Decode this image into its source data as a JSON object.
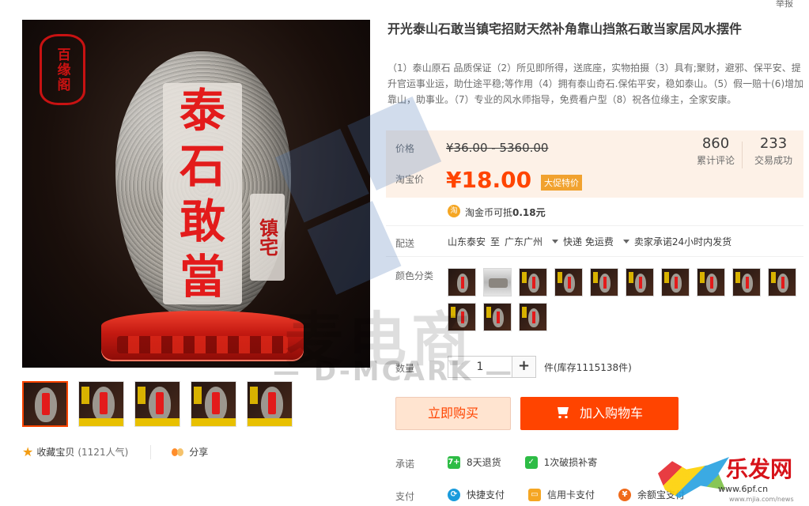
{
  "top": {
    "report_label": "举报"
  },
  "main_image": {
    "seal_text": "百缘阁",
    "carving_main": [
      "泰",
      "石",
      "敢",
      "當"
    ],
    "carving_side": "镇宅"
  },
  "watermark": {
    "text": "麦电商",
    "sub": "— D-MCARK —"
  },
  "thumbnails": [
    {
      "variant": "main",
      "active": true
    },
    {
      "variant": "gold",
      "active": false
    },
    {
      "variant": "gold",
      "active": false
    },
    {
      "variant": "gold",
      "active": false
    },
    {
      "variant": "gold",
      "active": false
    }
  ],
  "actions": {
    "favorite_label": "收藏宝贝",
    "favorite_count": "(1121人气)",
    "share_label": "分享"
  },
  "product": {
    "title": "开光泰山石敢当镇宅招财天然补角靠山挡煞石敢当家居风水摆件",
    "subtitle": "（1）泰山原石 品质保证（2）所见即所得，送底座，实物拍摄（3）具有;聚财，避邪、保平安、提升官运事业运，助仕途平稳;等作用（4）拥有泰山奇石.保佑平安，稳如泰山。（5）假一赔十(6)增加靠山，助事业。（7）专业的风水师指导，免费看户型（8）祝各位缘主，全家安康。"
  },
  "price": {
    "price_label": "价格",
    "original": "¥36.00 - 5360.00",
    "promo_label": "淘宝价",
    "promo_value": "¥18.00",
    "promo_tag": "大促特价",
    "reviews_count": "860",
    "reviews_label": "累计评论",
    "sales_count": "233",
    "sales_label": "交易成功"
  },
  "coin": {
    "icon": "淘",
    "text_prefix": "淘金币可抵",
    "amount": "0.18元"
  },
  "shipping": {
    "label": "配送",
    "from": "山东泰安",
    "to_word": "至",
    "destination": "广东广州",
    "method": "快递 免运费",
    "promise": "卖家承诺24小时内发货"
  },
  "colors": {
    "label": "颜色分类",
    "swatches": [
      "stone",
      "plain",
      "stone",
      "stone",
      "stone",
      "stone",
      "stone",
      "stone",
      "stone",
      "stone",
      "stone",
      "stone",
      "stone"
    ]
  },
  "quantity": {
    "label": "数量",
    "value": "1",
    "plus": "+",
    "stock": "件(库存1115138件)"
  },
  "buttons": {
    "buy_now": "立即购买",
    "add_to_cart": "加入购物车"
  },
  "promises": {
    "label": "承诺",
    "items": [
      {
        "icon": "7+",
        "text": "8天退货",
        "color": "#2dbc45"
      },
      {
        "icon": "✓",
        "text": "1次破损补寄",
        "color": "#2dbc45"
      }
    ]
  },
  "payment": {
    "label": "支付",
    "items": [
      {
        "icon": "⟳",
        "text": "快捷支付",
        "color": "#1a9bdc"
      },
      {
        "icon": "▭",
        "text": "信用卡支付",
        "color": "#f5a623"
      },
      {
        "icon": "¥",
        "text": "余额宝支付",
        "color": "#f06a1a"
      }
    ]
  },
  "corner": {
    "brand": "乐发网",
    "url": "www.6pf.cn",
    "url2": "www.mjia.com/news"
  },
  "colors_theme": {
    "accent": "#ff4400",
    "price_bg": "#fdf1e7",
    "tag": "#f1a22f"
  }
}
